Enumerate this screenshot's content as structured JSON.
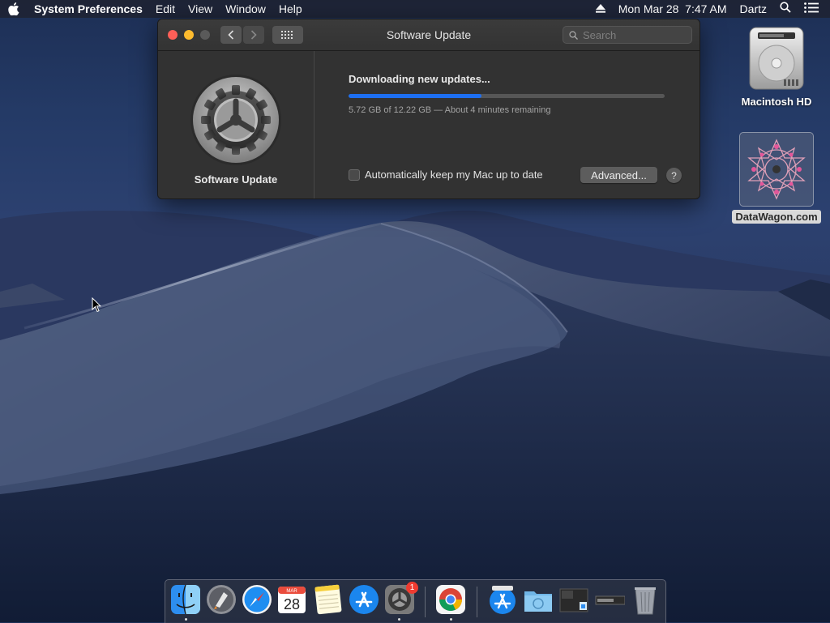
{
  "menubar": {
    "app_name": "System Preferences",
    "menus": [
      "Edit",
      "View",
      "Window",
      "Help"
    ],
    "clock": "Mon Mar 28  7:47 AM",
    "user": "Dartz"
  },
  "window": {
    "title": "Software Update",
    "search_placeholder": "Search",
    "pane_label": "Software Update",
    "status": "Downloading new updates...",
    "progress": {
      "fraction": 0.42
    },
    "detail": "5.72 GB of 12.22 GB — About 4 minutes remaining",
    "auto_update_label": "Automatically keep my Mac up to date",
    "auto_update_checked": false,
    "advanced_label": "Advanced...",
    "help_label": "?"
  },
  "desktop": {
    "hd_label": "Macintosh HD",
    "site_label": "DataWagon.com"
  },
  "dock": {
    "apps": [
      "finder-icon",
      "launchpad-icon",
      "safari-icon",
      "calendar-icon",
      "notes-icon",
      "app-store-icon",
      "system-preferences-icon",
      "chrome-icon",
      "applications-folder-icon",
      "downloads-folder-icon",
      "screenshot-stack-icon",
      "file-stack-icon",
      "trash-icon"
    ],
    "calendar_month": "MAR",
    "calendar_day": "28",
    "system_preferences_badge": "1"
  },
  "colors": {
    "accent": "#1d6ff2",
    "badge": "#ef3b30",
    "close": "#fe5f57",
    "minimize": "#febc2e",
    "zoom_disabled": "#5a5a5a"
  }
}
